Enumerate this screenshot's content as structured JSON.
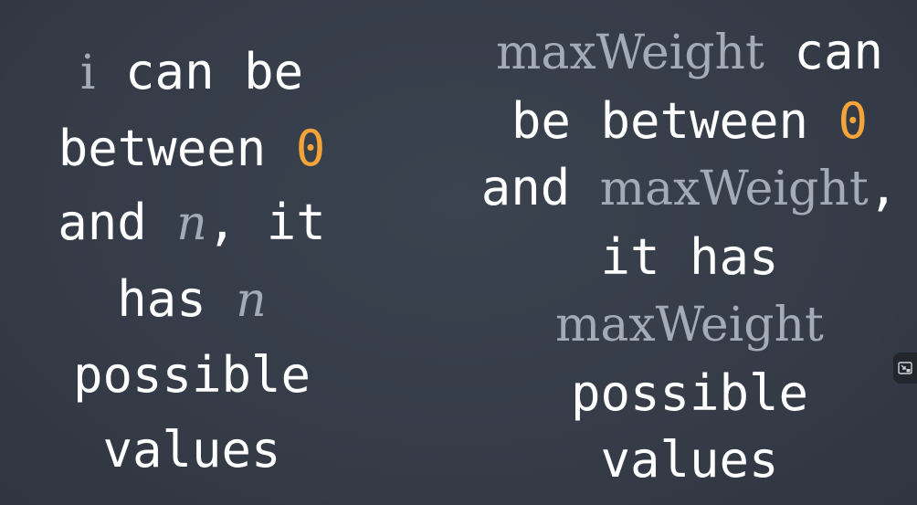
{
  "left": {
    "line1": {
      "var": "i",
      "text": " can be"
    },
    "line2": {
      "text": "between ",
      "num": "0"
    },
    "line3": {
      "text": "and ",
      "var": "n",
      "text2": ", it"
    },
    "line4": {
      "text": "has ",
      "var": "n"
    },
    "line5": {
      "text": "possible"
    },
    "line6": {
      "text": "values"
    }
  },
  "right": {
    "line1": {
      "var": "maxWeight",
      "text": " can"
    },
    "line2": {
      "text": "be between ",
      "num": "0"
    },
    "line3": {
      "text": "and ",
      "var": "maxWeight",
      "text2": ","
    },
    "line4": {
      "text": "it has"
    },
    "line5": {
      "var": "maxWeight"
    },
    "line6": {
      "text": "possible"
    },
    "line7": {
      "text": "values"
    }
  },
  "colors": {
    "background": "#363d49",
    "text": "#ffffff",
    "variable": "#a3abb8",
    "number": "#f5a43a"
  },
  "icons": {
    "corner": "picture-in-picture-icon"
  }
}
